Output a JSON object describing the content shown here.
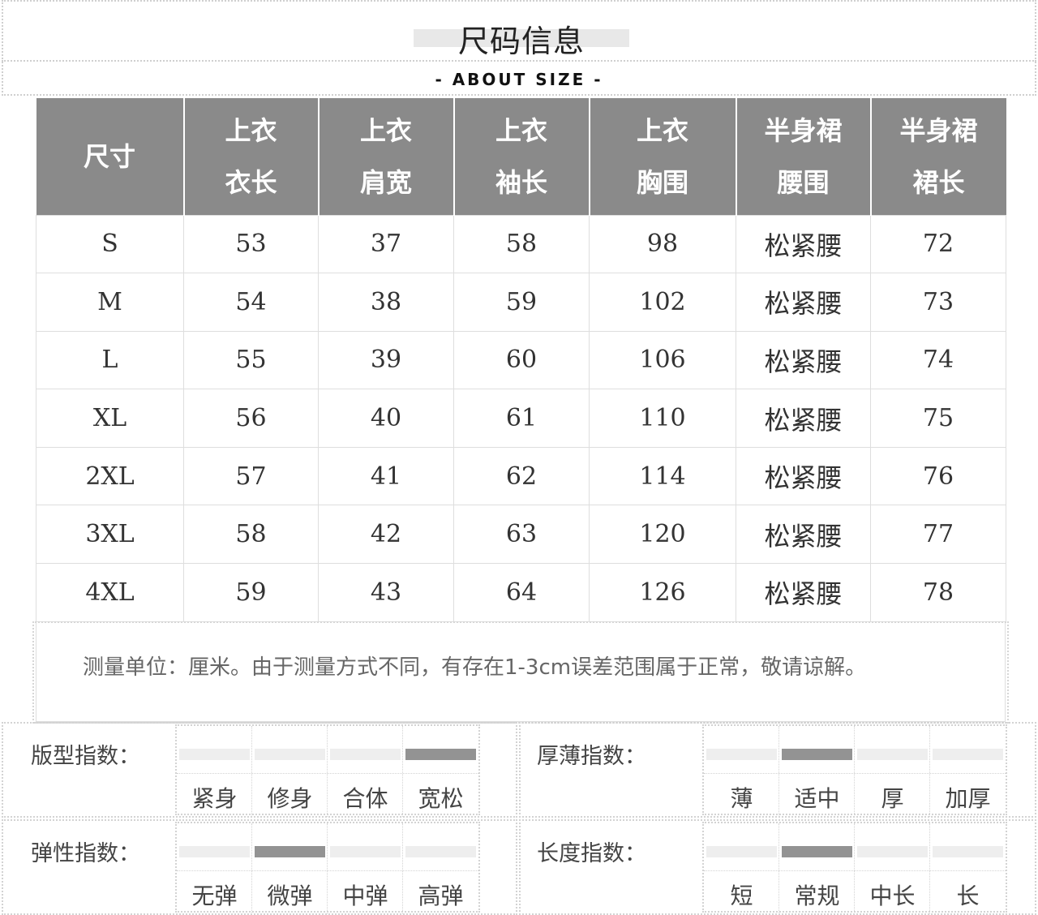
{
  "title": "尺码信息",
  "subtitle": "- ABOUT SIZE -",
  "table": {
    "headers": [
      {
        "line1": "尺寸",
        "line2": ""
      },
      {
        "line1": "上衣",
        "line2": "衣长"
      },
      {
        "line1": "上衣",
        "line2": "肩宽"
      },
      {
        "line1": "上衣",
        "line2": "袖长"
      },
      {
        "line1": "上衣",
        "line2": "胸围"
      },
      {
        "line1": "半身裙",
        "line2": "腰围"
      },
      {
        "line1": "半身裙",
        "line2": "裙长"
      }
    ],
    "rows": [
      [
        "S",
        "53",
        "37",
        "58",
        "98",
        "松紧腰",
        "72"
      ],
      [
        "M",
        "54",
        "38",
        "59",
        "102",
        "松紧腰",
        "73"
      ],
      [
        "L",
        "55",
        "39",
        "60",
        "106",
        "松紧腰",
        "74"
      ],
      [
        "XL",
        "56",
        "40",
        "61",
        "110",
        "松紧腰",
        "75"
      ],
      [
        "2XL",
        "57",
        "41",
        "62",
        "114",
        "松紧腰",
        "76"
      ],
      [
        "3XL",
        "58",
        "42",
        "63",
        "120",
        "松紧腰",
        "77"
      ],
      [
        "4XL",
        "59",
        "43",
        "64",
        "126",
        "松紧腰",
        "78"
      ]
    ]
  },
  "note": "测量单位：厘米。由于测量方式不同，有存在1-3cm误差范围属于正常，敬请谅解。",
  "indices": {
    "fit": {
      "label": "版型指数：",
      "options": [
        "紧身",
        "修身",
        "合体",
        "宽松"
      ],
      "selected": 3
    },
    "thickness": {
      "label": "厚薄指数：",
      "options": [
        "薄",
        "适中",
        "厚",
        "加厚"
      ],
      "selected": 1
    },
    "elasticity": {
      "label": "弹性指数：",
      "options": [
        "无弹",
        "微弹",
        "中弹",
        "高弹"
      ],
      "selected": 1
    },
    "length": {
      "label": "长度指数：",
      "options": [
        "短",
        "常规",
        "中长",
        "长"
      ],
      "selected": 1
    }
  },
  "colors": {
    "header_bg": "#8a8a8a",
    "bar_selected": "#939393",
    "bar_unselected": "#eeeeee"
  }
}
